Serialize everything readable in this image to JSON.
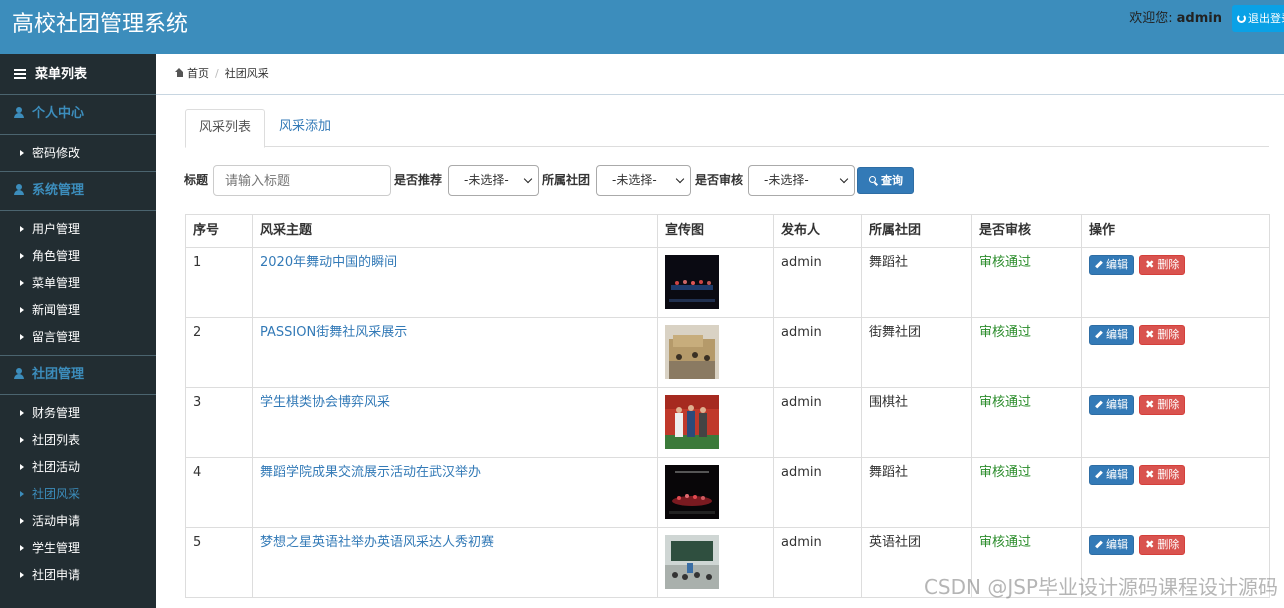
{
  "header": {
    "title": "高校社团管理系统",
    "welcome_label": "欢迎您:",
    "username": "admin",
    "logout_label": "退出登录"
  },
  "sidebar": {
    "menu_title": "菜单列表",
    "sections": [
      {
        "title": "个人中心",
        "items": [
          {
            "label": "密码修改"
          }
        ]
      },
      {
        "title": "系统管理",
        "items": [
          {
            "label": "用户管理"
          },
          {
            "label": "角色管理"
          },
          {
            "label": "菜单管理"
          },
          {
            "label": "新闻管理"
          },
          {
            "label": "留言管理"
          }
        ]
      },
      {
        "title": "社团管理",
        "items": [
          {
            "label": "财务管理"
          },
          {
            "label": "社团列表"
          },
          {
            "label": "社团活动"
          },
          {
            "label": "社团风采",
            "active": true
          },
          {
            "label": "活动申请"
          },
          {
            "label": "学生管理"
          },
          {
            "label": "社团申请"
          }
        ]
      }
    ]
  },
  "breadcrumb": {
    "home": "首页",
    "current": "社团风采"
  },
  "tabs": [
    {
      "label": "风采列表",
      "active": true
    },
    {
      "label": "风采添加"
    }
  ],
  "filters": {
    "title_label": "标题",
    "title_placeholder": "请输入标题",
    "recommend_label": "是否推荐",
    "recommend_value": "-未选择-",
    "club_label": "所属社团",
    "club_value": "-未选择-",
    "audit_label": "是否审核",
    "audit_value": "-未选择-",
    "query_button": "查询"
  },
  "table": {
    "headers": [
      "序号",
      "风采主题",
      "宣传图",
      "发布人",
      "所属社团",
      "是否审核",
      "操作"
    ],
    "edit_label": "编辑",
    "delete_label": "删除",
    "rows": [
      {
        "no": "1",
        "title": "2020年舞动中国的瞬间",
        "image": "dance-stage-photo",
        "publisher": "admin",
        "club": "舞蹈社",
        "status": "审核通过"
      },
      {
        "no": "2",
        "title": "PASSION街舞社风采展示",
        "image": "street-dance-group-photo",
        "publisher": "admin",
        "club": "街舞社团",
        "status": "审核通过"
      },
      {
        "no": "3",
        "title": "学生棋类协会博弈风采",
        "image": "chess-association-photo",
        "publisher": "admin",
        "club": "围棋社",
        "status": "审核通过"
      },
      {
        "no": "4",
        "title": "舞蹈学院成果交流展示活动在武汉举办",
        "image": "dance-performance-photo",
        "publisher": "admin",
        "club": "舞蹈社",
        "status": "审核通过"
      },
      {
        "no": "5",
        "title": "梦想之星英语社举办英语风采达人秀初赛",
        "image": "english-contest-photo",
        "publisher": "admin",
        "club": "英语社团",
        "status": "审核通过"
      }
    ]
  },
  "watermark": "CSDN @JSP毕业设计源码课程设计源码"
}
